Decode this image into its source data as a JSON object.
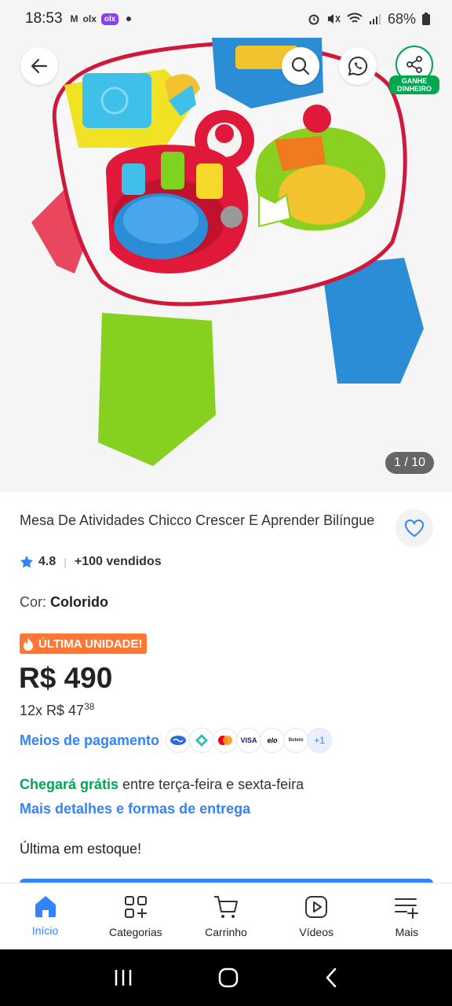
{
  "status_bar": {
    "time": "18:53",
    "apps": [
      "M",
      "olx",
      "olx"
    ],
    "battery": "68%"
  },
  "hero": {
    "image_counter": "1 / 10",
    "share_badge_line1": "GANHE",
    "share_badge_line2": "DINHEIRO"
  },
  "product": {
    "title": "Mesa De Atividades Chicco Crescer E Aprender Bilíngue",
    "rating": "4.8",
    "sold": "+100 vendidos",
    "variant_label": "Cor:",
    "variant_value": "Colorido",
    "badge": "ÚLTIMA UNIDADE!",
    "price": "R$ 490",
    "installments_prefix": "12x R$ 47",
    "installments_cents": "38",
    "payment_link": "Meios de pagamento",
    "payment_icons": [
      "mercado-pago",
      "pix",
      "mastercard",
      "VISA",
      "elo",
      "Boleto",
      "+1"
    ],
    "delivery_free": "Chegará grátis",
    "delivery_rest": " entre terça-feira e sexta-feira",
    "delivery_link": "Mais detalhes e formas de entrega",
    "stock_text": "Última em estoque!"
  },
  "bottom_nav": {
    "items": [
      {
        "label": "Início",
        "icon": "home-icon",
        "active": true
      },
      {
        "label": "Categorias",
        "icon": "categories-icon",
        "active": false
      },
      {
        "label": "Carrinho",
        "icon": "cart-icon",
        "active": false
      },
      {
        "label": "Vídeos",
        "icon": "video-icon",
        "active": false
      },
      {
        "label": "Mais",
        "icon": "menu-plus-icon",
        "active": false
      }
    ]
  },
  "colors": {
    "accent": "#3483fa",
    "green": "#00a650",
    "badge_orange": "#ff7733"
  }
}
